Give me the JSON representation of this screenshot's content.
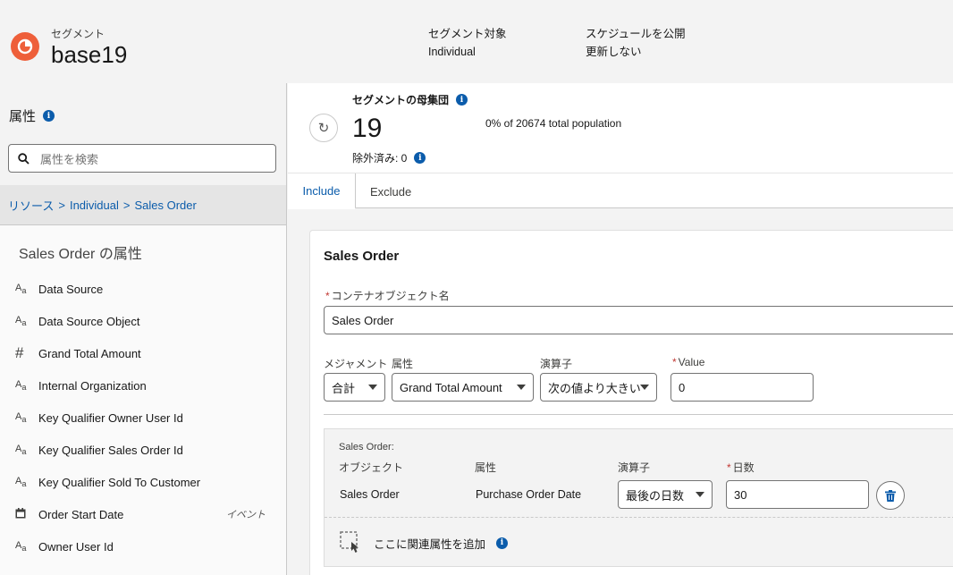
{
  "header": {
    "kicker": "セグメント",
    "title": "base19",
    "target_label": "セグメント対象",
    "target_value": "Individual",
    "schedule_label": "スケジュールを公開",
    "schedule_value": "更新しない"
  },
  "left_panel": {
    "title": "属性",
    "search_placeholder": "属性を検索",
    "breadcrumb": [
      "リソース",
      "Individual",
      "Sales Order"
    ],
    "attr_heading": "Sales Order の属性",
    "attributes": [
      {
        "icon": "text-type-icon",
        "label": "Data Source",
        "tag": ""
      },
      {
        "icon": "text-type-icon",
        "label": "Data Source Object",
        "tag": ""
      },
      {
        "icon": "number-type-icon",
        "label": "Grand Total Amount",
        "tag": ""
      },
      {
        "icon": "text-type-icon",
        "label": "Internal Organization",
        "tag": ""
      },
      {
        "icon": "text-type-icon",
        "label": "Key Qualifier Owner User Id",
        "tag": ""
      },
      {
        "icon": "text-type-icon",
        "label": "Key Qualifier Sales Order Id",
        "tag": ""
      },
      {
        "icon": "text-type-icon",
        "label": "Key Qualifier Sold To Customer",
        "tag": ""
      },
      {
        "icon": "date-type-icon",
        "label": "Order Start Date",
        "tag": "イベント"
      },
      {
        "icon": "text-type-icon",
        "label": "Owner User Id",
        "tag": ""
      }
    ]
  },
  "population": {
    "label": "セグメントの母集団",
    "count": "19",
    "percent_text": "0% of 20674 total population",
    "excluded_text": "除外済み: 0"
  },
  "tabs": {
    "include": "Include",
    "exclude": "Exclude"
  },
  "rule": {
    "title": "Sales Order",
    "container_label": "コンテナオブジェクト名",
    "container_value": "Sales Order",
    "measurement_label": "メジャメント",
    "measurement_value": "合計",
    "attribute_label": "属性",
    "attribute_value": "Grand Total Amount",
    "operator_label": "演算子",
    "operator_value": "次の値より大きい",
    "value_label": "Value",
    "value_value": "0"
  },
  "related": {
    "kicker": "Sales Order:",
    "object_label": "オブジェクト",
    "attribute_label": "属性",
    "operator_label": "演算子",
    "days_label": "日数",
    "object_value": "Sales Order",
    "attribute_value": "Purchase Order Date",
    "operator_value": "最後の日数",
    "days_value": "30",
    "add_text": "ここに関連属性を追加"
  },
  "colors": {
    "brand": "#0b5cab",
    "logo": "#ee5f3a",
    "required": "#c23934"
  }
}
